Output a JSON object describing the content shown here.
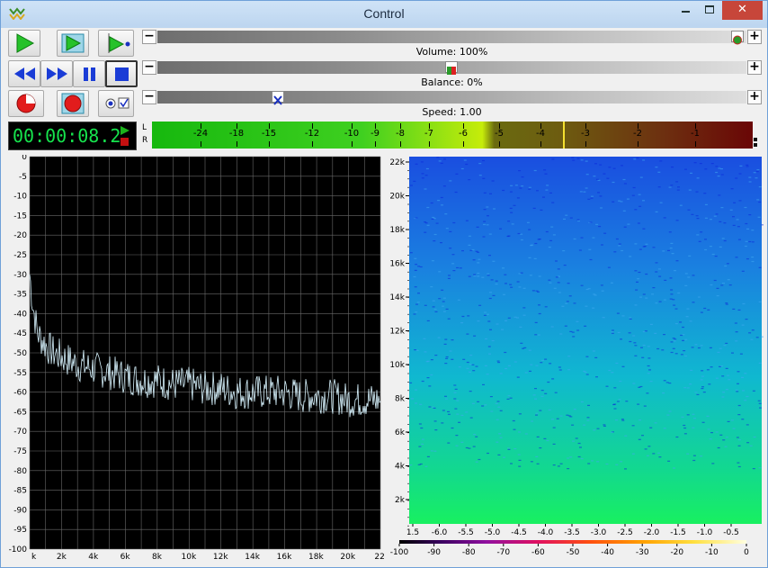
{
  "window": {
    "title": "Control"
  },
  "window_controls": {
    "minimize": "",
    "maximize": "",
    "close": "✕"
  },
  "transport": {
    "play": "play",
    "play_loop": "play-loop",
    "play_cursor": "play-from-cursor",
    "rewind": "rewind",
    "forward": "fast-forward",
    "pause": "pause",
    "stop": "stop",
    "record": "record",
    "record_new": "record-new"
  },
  "volume": {
    "label": "Volume: 100%",
    "value": 1.0
  },
  "balance": {
    "label": "Balance: 0%",
    "value": 0.5
  },
  "speed": {
    "label": "Speed: 1.00",
    "value": 0.21
  },
  "slider_buttons": {
    "minus": "−",
    "plus": "+"
  },
  "time": {
    "display": "00:00:08.2"
  },
  "meter": {
    "channels": [
      "L",
      "R"
    ],
    "scale": [
      "-24",
      "-18",
      "-15",
      "-12",
      "-10",
      "-9",
      "-8",
      "-7",
      "-6",
      "-5",
      "-4",
      "-3",
      "-2",
      "-1"
    ],
    "peak_db": -3.6
  },
  "colors": {
    "titlebar": "#c6dcf3",
    "close": "#c7463a",
    "time_text": "#16e34d",
    "spectrum_bg": "#000000",
    "spectrum_trace": "#d8f4ff",
    "spectrogram_low": "#0a28d8",
    "spectrogram_high": "#18e070"
  },
  "chart_data": [
    {
      "type": "line",
      "ylabel": "",
      "xlabel": "",
      "y_ticks": [
        "0",
        "-5",
        "-10",
        "-15",
        "-20",
        "-25",
        "-30",
        "-35",
        "-40",
        "-45",
        "-50",
        "-55",
        "-60",
        "-65",
        "-70",
        "-75",
        "-80",
        "-85",
        "-90",
        "-95",
        "-100"
      ],
      "x_ticks": [
        "k",
        "2k",
        "4k",
        "6k",
        "8k",
        "10k",
        "12k",
        "14k",
        "16k",
        "18k",
        "20k",
        "22"
      ],
      "ylim": [
        -100,
        0
      ],
      "xlim": [
        0,
        22050
      ],
      "grid": true,
      "series": [
        {
          "x": [
            0,
            200,
            500,
            1000,
            1500,
            2000,
            3000,
            4000,
            5000,
            6000,
            7000,
            8000,
            9000,
            10000,
            11000,
            12000,
            13000,
            14000,
            15000,
            16000,
            17000,
            18000,
            19000,
            20000,
            21000,
            22000
          ],
          "values": [
            -30,
            -38,
            -45,
            -48,
            -50,
            -51,
            -53,
            -54,
            -55,
            -56,
            -57,
            -57,
            -58,
            -58,
            -59,
            -59,
            -60,
            -60,
            -60,
            -60,
            -61,
            -61,
            -61,
            -62,
            -62,
            -62
          ]
        }
      ]
    },
    {
      "type": "heatmap",
      "y_ticks": [
        "22k",
        "20k",
        "18k",
        "16k",
        "14k",
        "12k",
        "10k",
        "8k",
        "6k",
        "4k",
        "2k"
      ],
      "x_ticks": [
        "1.5",
        "-6.0",
        "-5.5",
        "-5.0",
        "-4.5",
        "-4.0",
        "-3.5",
        "-3.0",
        "-2.5",
        "-2.0",
        "-1.5",
        "-1.0",
        "-0.5"
      ],
      "color_scale_ticks": [
        "-100",
        "-90",
        "-80",
        "-70",
        "-60",
        "-50",
        "-40",
        "-30",
        "-20",
        "-10",
        "0"
      ]
    }
  ]
}
